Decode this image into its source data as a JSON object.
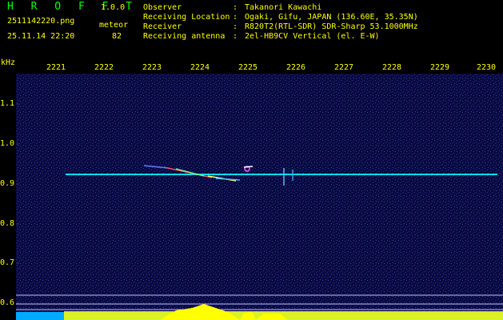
{
  "header": {
    "app_title": "H R O F F T",
    "version": "1.0.0",
    "file_name": "2511142220.png",
    "timestamp": "25.11.14 22:20",
    "meteor_label": "meteor",
    "meteor_count": "82",
    "info": [
      {
        "label": "Observer",
        "value": "Takanori Kawachi"
      },
      {
        "label": "Receiving Location",
        "value": "Ogaki, Gifu, JAPAN (136.60E, 35.35N)"
      },
      {
        "label": "Receiver",
        "value": "R820T2(RTL-SDR) SDR-Sharp 53.1000MHz"
      },
      {
        "label": "Receiving antenna",
        "value": "2el-HB9CV Vertical (el. E-W)"
      }
    ],
    "separator": ":"
  },
  "spectrogram": {
    "y_unit": "kHz",
    "x_ticks": [
      "2221",
      "2222",
      "2223",
      "2224",
      "2225",
      "2226",
      "2227",
      "2228",
      "2229",
      "2230"
    ],
    "y_ticks": [
      "1.1",
      "1.0",
      "0.9",
      "0.8",
      "0.7",
      "0.6"
    ],
    "colors": {
      "background": "#0a0a40",
      "text": "#ffff00",
      "title": "#00ff00",
      "carrier": "#00e0ff",
      "grid": "#8080ff"
    }
  }
}
